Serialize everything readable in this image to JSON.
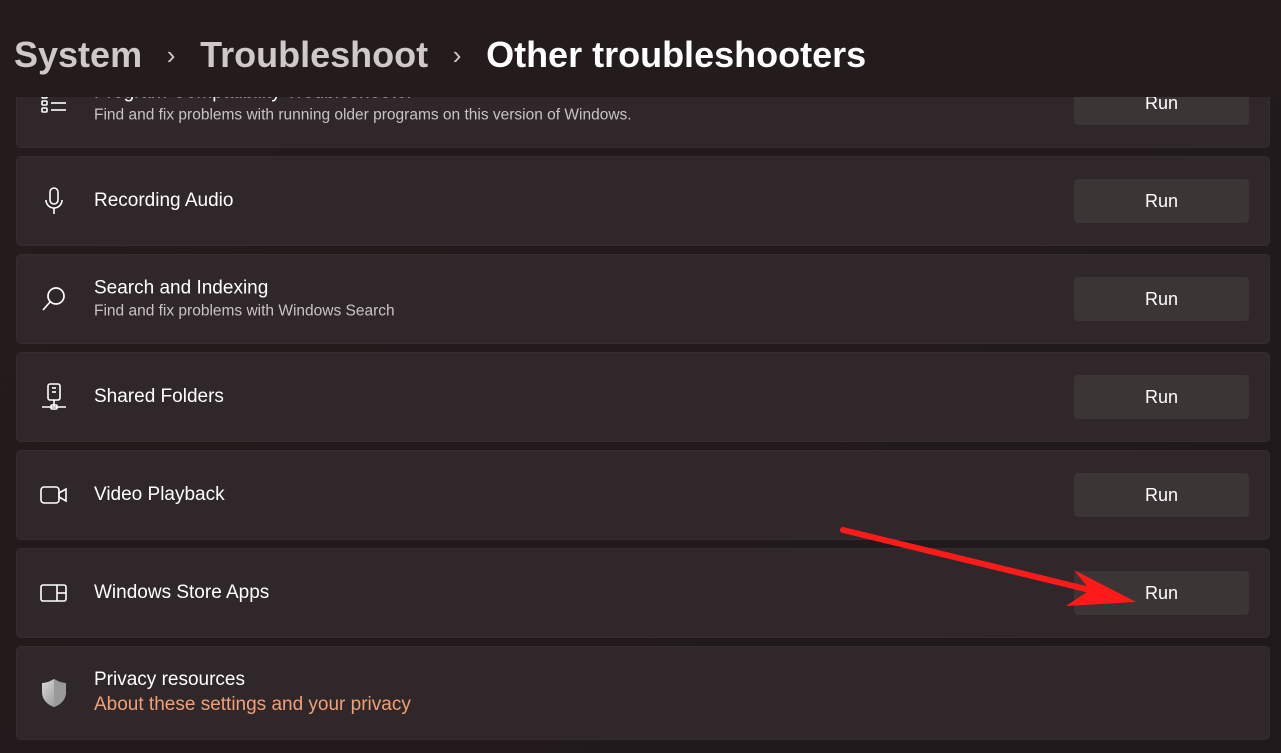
{
  "breadcrumb": {
    "items": [
      "System",
      "Troubleshoot"
    ],
    "separator": "›",
    "current": "Other troubleshooters"
  },
  "troubleshooters": [
    {
      "title": "Program Compatibility Troubleshooter",
      "description": "Find and fix problems with running older programs on this version of Windows.",
      "icon": "list-settings-icon",
      "button": "Run"
    },
    {
      "title": "Recording Audio",
      "description": "",
      "icon": "microphone-icon",
      "button": "Run"
    },
    {
      "title": "Search and Indexing",
      "description": "Find and fix problems with Windows Search",
      "icon": "search-icon",
      "button": "Run"
    },
    {
      "title": "Shared Folders",
      "description": "",
      "icon": "network-drive-icon",
      "button": "Run"
    },
    {
      "title": "Video Playback",
      "description": "",
      "icon": "video-camera-icon",
      "button": "Run"
    },
    {
      "title": "Windows Store Apps",
      "description": "",
      "icon": "store-apps-icon",
      "button": "Run"
    }
  ],
  "privacy": {
    "title": "Privacy resources",
    "link": "About these settings and your privacy",
    "icon": "shield-icon"
  },
  "colors": {
    "background": "#221a1b",
    "card": "#2f2729",
    "button": "#3c3536",
    "link": "#f0a078",
    "annotation_arrow": "#ff1a1a"
  }
}
